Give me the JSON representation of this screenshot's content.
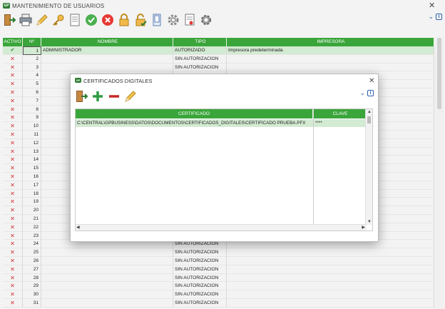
{
  "window": {
    "logo_text": "GP",
    "title": "MANTENIMIENTO DE USUARIOS"
  },
  "main_table": {
    "headers": [
      "ACTIVO",
      "Nº",
      "NOMBRE",
      "TIPO",
      "IMPRESORA"
    ],
    "rows": [
      {
        "active": true,
        "num": "1",
        "name": "ADMINISTRADOR",
        "type": "AUTORIZADO",
        "printer": "Impresora predeterminada"
      },
      {
        "active": false,
        "num": "2",
        "name": "",
        "type": "SIN AUTORIZACION",
        "printer": ""
      },
      {
        "active": false,
        "num": "3",
        "name": "",
        "type": "SIN AUTORIZACION",
        "printer": ""
      },
      {
        "active": false,
        "num": "4",
        "name": "",
        "type": "",
        "printer": ""
      },
      {
        "active": false,
        "num": "5",
        "name": "",
        "type": "",
        "printer": ""
      },
      {
        "active": false,
        "num": "6",
        "name": "",
        "type": "",
        "printer": ""
      },
      {
        "active": false,
        "num": "7",
        "name": "",
        "type": "",
        "printer": ""
      },
      {
        "active": false,
        "num": "8",
        "name": "",
        "type": "",
        "printer": ""
      },
      {
        "active": false,
        "num": "9",
        "name": "",
        "type": "",
        "printer": ""
      },
      {
        "active": false,
        "num": "10",
        "name": "",
        "type": "",
        "printer": ""
      },
      {
        "active": false,
        "num": "11",
        "name": "",
        "type": "",
        "printer": ""
      },
      {
        "active": false,
        "num": "12",
        "name": "",
        "type": "",
        "printer": ""
      },
      {
        "active": false,
        "num": "13",
        "name": "",
        "type": "",
        "printer": ""
      },
      {
        "active": false,
        "num": "14",
        "name": "",
        "type": "",
        "printer": ""
      },
      {
        "active": false,
        "num": "15",
        "name": "",
        "type": "",
        "printer": ""
      },
      {
        "active": false,
        "num": "16",
        "name": "",
        "type": "",
        "printer": ""
      },
      {
        "active": false,
        "num": "17",
        "name": "",
        "type": "",
        "printer": ""
      },
      {
        "active": false,
        "num": "18",
        "name": "",
        "type": "",
        "printer": ""
      },
      {
        "active": false,
        "num": "19",
        "name": "",
        "type": "",
        "printer": ""
      },
      {
        "active": false,
        "num": "20",
        "name": "",
        "type": "",
        "printer": ""
      },
      {
        "active": false,
        "num": "21",
        "name": "",
        "type": "",
        "printer": ""
      },
      {
        "active": false,
        "num": "22",
        "name": "",
        "type": "",
        "printer": ""
      },
      {
        "active": false,
        "num": "23",
        "name": "",
        "type": "",
        "printer": ""
      },
      {
        "active": false,
        "num": "24",
        "name": "",
        "type": "SIN AUTORIZACION",
        "printer": ""
      },
      {
        "active": false,
        "num": "25",
        "name": "",
        "type": "SIN AUTORIZACION",
        "printer": ""
      },
      {
        "active": false,
        "num": "26",
        "name": "",
        "type": "SIN AUTORIZACION",
        "printer": ""
      },
      {
        "active": false,
        "num": "27",
        "name": "",
        "type": "SIN AUTORIZACION",
        "printer": ""
      },
      {
        "active": false,
        "num": "28",
        "name": "",
        "type": "SIN AUTORIZACION",
        "printer": ""
      },
      {
        "active": false,
        "num": "29",
        "name": "",
        "type": "SIN AUTORIZACION",
        "printer": ""
      },
      {
        "active": false,
        "num": "30",
        "name": "",
        "type": "SIN AUTORIZACION",
        "printer": ""
      },
      {
        "active": false,
        "num": "31",
        "name": "",
        "type": "SIN AUTORIZACION",
        "printer": ""
      }
    ]
  },
  "toolbar": {
    "icons": [
      "exit-icon",
      "printer-icon",
      "pencil-icon",
      "key-icon",
      "document-icon",
      "check-icon",
      "cancel-icon",
      "lock-icon",
      "unlock-icon",
      "device-icon",
      "gear-icon",
      "certificate-icon",
      "settings-gear-icon"
    ]
  },
  "dialog": {
    "logo_text": "GP",
    "title": "CERTIFICADOS DIGITALES",
    "headers": [
      "CERTIFICADO",
      "CLAVE"
    ],
    "rows": [
      {
        "certificado": "C:\\CENTRAL\\GPBUSINESS\\DATOS\\DOCUMENTOS\\CERTIFICADOS_DIGITALES\\CERTIFICADO PRUEBA.PFX",
        "clave": "****"
      }
    ]
  },
  "colors": {
    "header_green": "#3aa53a",
    "selected_row": "#d3ead3",
    "x_red": "#d32f2f"
  }
}
